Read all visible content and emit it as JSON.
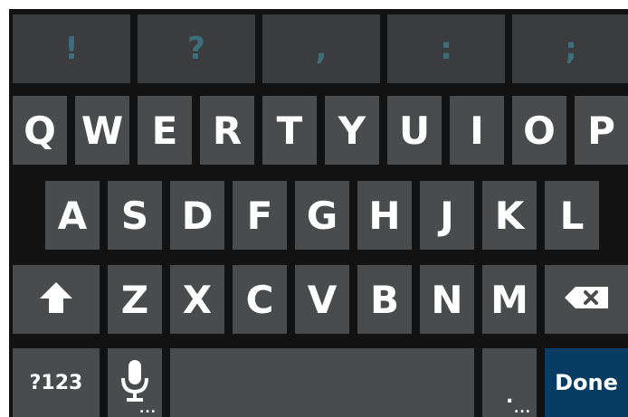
{
  "punctuation_row": [
    "!",
    "?",
    ",",
    ":",
    ";"
  ],
  "row1": [
    "Q",
    "W",
    "E",
    "R",
    "T",
    "Y",
    "U",
    "I",
    "O",
    "P"
  ],
  "row2": [
    "A",
    "S",
    "D",
    "F",
    "G",
    "H",
    "J",
    "K",
    "L"
  ],
  "row3": [
    "Z",
    "X",
    "C",
    "V",
    "B",
    "N",
    "M"
  ],
  "bottom_row": {
    "symbols_label": "?123",
    "mic_more_indicator": "...",
    "period_label": ".",
    "period_more_indicator": "...",
    "done_label": "Done"
  },
  "icons": {
    "shift": "shift-icon",
    "backspace": "backspace-icon",
    "microphone": "microphone-icon"
  },
  "colors": {
    "keyboard_background": "#121212",
    "key_background": "#4a4b4c",
    "punctuation_key_background": "#3b3c3d",
    "punctuation_text": "#3d6e7e",
    "key_text": "#ffffff",
    "done_background": "#083c62"
  }
}
